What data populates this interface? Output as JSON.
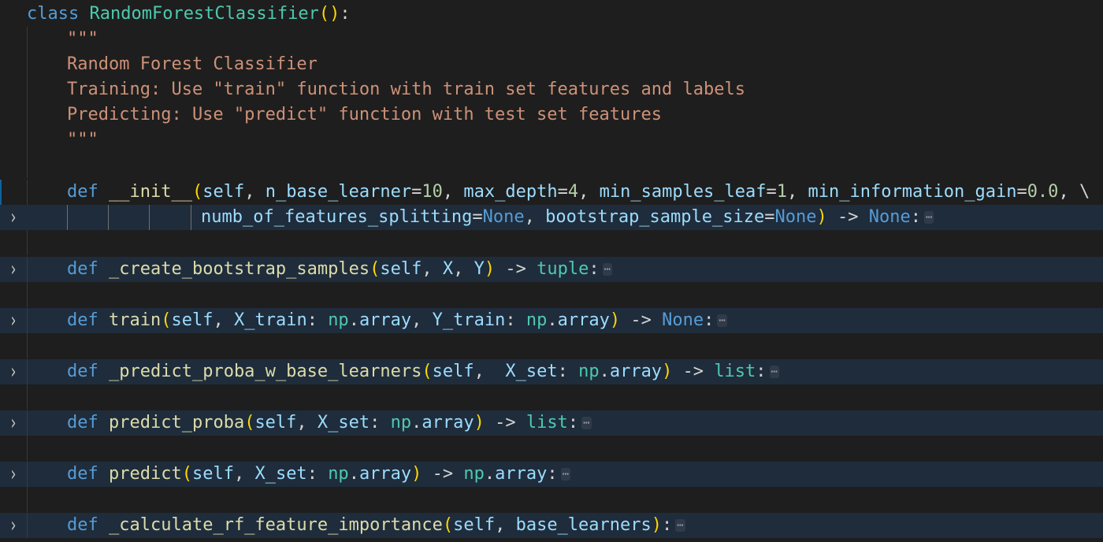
{
  "editor": {
    "class_def": {
      "kw": "class",
      "name": "RandomForestClassifier",
      "open": "(",
      "close": ")",
      "colon": ":"
    },
    "docstring": {
      "open": "\"\"\"",
      "line1": "Random Forest Classifier",
      "line2": "Training: Use \"train\" function with train set features and labels",
      "line3": "Predicting: Use \"predict\" function with test set features",
      "close": "\"\"\""
    },
    "init": {
      "kw": "def",
      "name": "__init__",
      "p_self": "self",
      "p_nbl": "n_base_learner",
      "v_nbl": "10",
      "p_md": "max_depth",
      "v_md": "4",
      "p_msl": "min_samples_leaf",
      "v_msl": "1",
      "p_mig": "min_information_gain",
      "v_mig": "0.0",
      "cont": "\\",
      "p_nfs": "numb_of_features_splitting",
      "v_nfs": "None",
      "p_bss": "bootstrap_sample_size",
      "v_bss": "None",
      "arrow": "->",
      "ret": "None"
    },
    "m_bootstrap": {
      "kw": "def",
      "name": "_create_bootstrap_samples",
      "p1": "self",
      "p2": "X",
      "p3": "Y",
      "arrow": "->",
      "ret": "tuple"
    },
    "m_train": {
      "kw": "def",
      "name": "train",
      "p1": "self",
      "p2": "X_train",
      "t2": "np",
      "t2b": "array",
      "p3": "Y_train",
      "t3": "np",
      "t3b": "array",
      "arrow": "->",
      "ret": "None"
    },
    "m_ppbl": {
      "kw": "def",
      "name": "_predict_proba_w_base_learners",
      "p1": "self",
      "p2": "X_set",
      "t2": "np",
      "t2b": "array",
      "arrow": "->",
      "ret": "list"
    },
    "m_pp": {
      "kw": "def",
      "name": "predict_proba",
      "p1": "self",
      "p2": "X_set",
      "t2": "np",
      "t2b": "array",
      "arrow": "->",
      "ret": "list"
    },
    "m_predict": {
      "kw": "def",
      "name": "predict",
      "p1": "self",
      "p2": "X_set",
      "t2": "np",
      "t2b": "array",
      "arrow": "->",
      "ret": "np",
      "retb": "array"
    },
    "m_calc": {
      "kw": "def",
      "name": "_calculate_rf_feature_importance",
      "p1": "self",
      "p2": "base_learners"
    },
    "fold_glyph": "›",
    "ellipsis": "⋯"
  }
}
